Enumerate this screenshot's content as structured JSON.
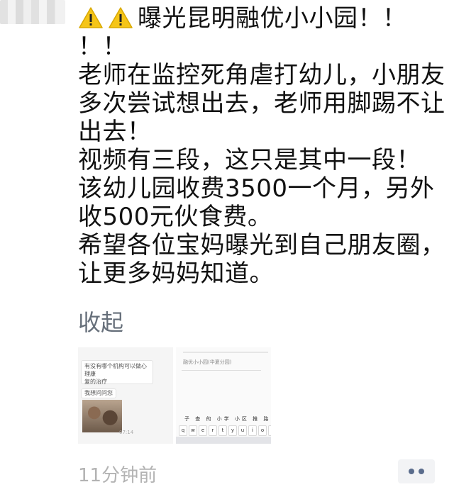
{
  "post": {
    "text_lines": [
      "曝光昆明融优小小园！！",
      "！！",
      "老师在监控死角虐打幼儿，小朋友",
      "多次尝试想出去，老师用脚踢不让",
      "出去！",
      "视频有三段，这只是其中一段！",
      "该幼儿园收费3500一个月，另外",
      "收500元伙食费。",
      "希望各位宝妈曝光到自己朋友圈，",
      "让更多妈妈知道。"
    ],
    "warning_icons": [
      "warning-icon",
      "warning-icon"
    ],
    "collapse_label": "收起",
    "time_label": "11分钟前"
  },
  "thumbnails": {
    "chat_bubble_text": "有没有哪个机构可以做心理康\n复的治疗",
    "chat_bubble_text_2": "我想问问您",
    "chat_time": "07:14",
    "input_text": "融优小小园(华夏分园)",
    "candidates": "子 查 的 小学 小区 推 路 ^",
    "keys": [
      "q",
      "w",
      "e",
      "r",
      "t",
      "y",
      "u",
      "i",
      "o",
      "p"
    ]
  },
  "colors": {
    "link": "#666f7a",
    "time": "#b3b3b3",
    "more_bg": "#f2f3f5",
    "more_dot": "#5a6c8c",
    "warning_fill": "#f5c518"
  }
}
